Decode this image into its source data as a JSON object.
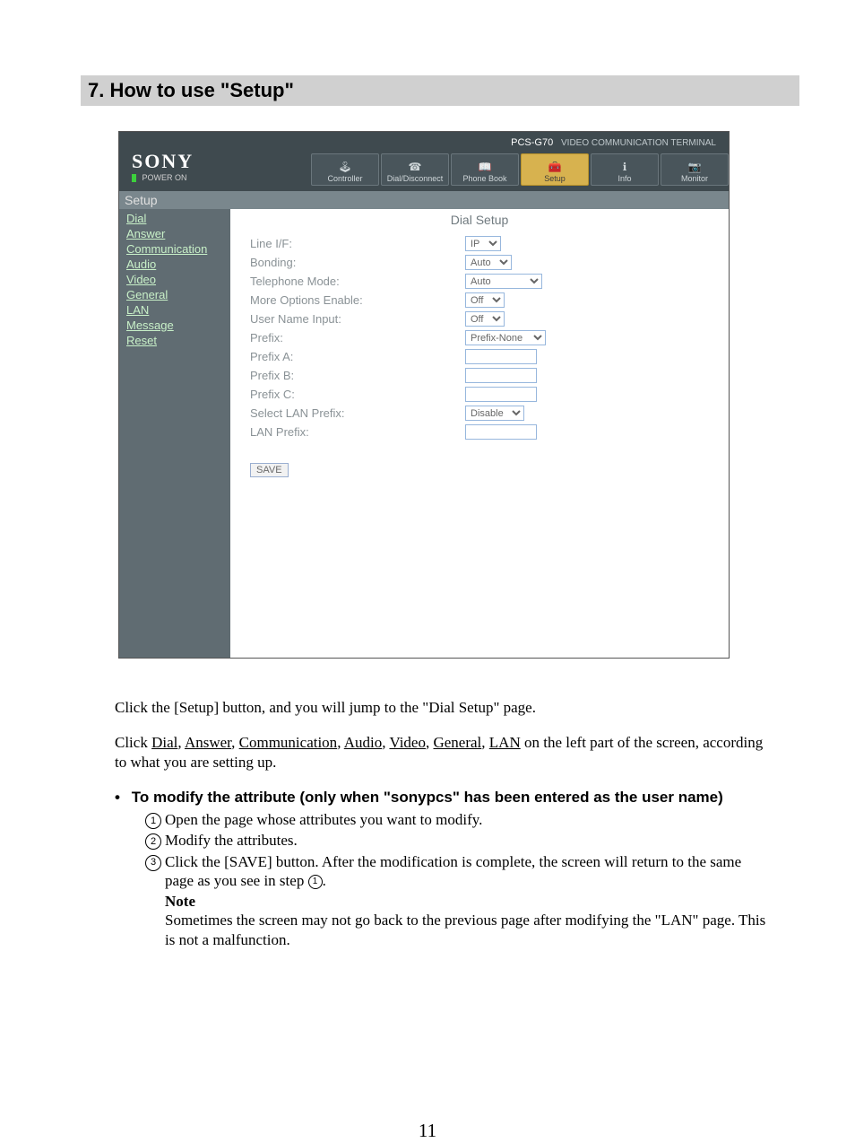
{
  "section": {
    "number": "7.",
    "title": "How to use \"Setup\""
  },
  "app": {
    "brand": "SONY",
    "power": "POWER ON",
    "model": "PCS-G70",
    "model_sub": "VIDEO COMMUNICATION TERMINAL",
    "tabs": {
      "controller": "Controller",
      "dial": "Dial/Disconnect",
      "phonebook": "Phone Book",
      "setup": "Setup",
      "info": "Info",
      "monitor": "Monitor"
    },
    "setup_label": "Setup",
    "sidebar": {
      "dial": "Dial",
      "answer": "Answer",
      "communication": "Communication",
      "audio": "Audio",
      "video": "Video",
      "general": "General",
      "lan": "LAN",
      "message": "Message",
      "reset": "Reset"
    },
    "content_title": "Dial Setup",
    "form": {
      "line_if": {
        "label": "Line I/F:",
        "value": "IP"
      },
      "bonding": {
        "label": "Bonding:",
        "value": "Auto"
      },
      "tel_mode": {
        "label": "Telephone Mode:",
        "value": "Auto"
      },
      "more_opts": {
        "label": "More Options Enable:",
        "value": "Off"
      },
      "user_name": {
        "label": "User Name Input:",
        "value": "Off"
      },
      "prefix": {
        "label": "Prefix:",
        "value": "Prefix-None"
      },
      "prefix_a": {
        "label": "Prefix A:",
        "value": ""
      },
      "prefix_b": {
        "label": "Prefix B:",
        "value": ""
      },
      "prefix_c": {
        "label": "Prefix C:",
        "value": ""
      },
      "sel_lan_prefix": {
        "label": "Select LAN Prefix:",
        "value": "Disable"
      },
      "lan_prefix": {
        "label": "LAN Prefix:",
        "value": ""
      }
    },
    "save": "SAVE"
  },
  "instr": {
    "p1a": "Click the [Setup] button, and you will jump to the \"Dial Setup\" page.",
    "p2_pre": "Click ",
    "links": {
      "dial": "Dial",
      "answer": "Answer",
      "communication": "Communication",
      "audio": "Audio",
      "video": "Video",
      "general": "General",
      "lan": "LAN"
    },
    "p2_post": " on the left part of the screen, according to what you are setting up.",
    "bullet": "To modify the attribute (only when \"sonypcs\" has been entered as the user name)",
    "s1": "Open the page whose attributes you want to modify.",
    "s2": "Modify the attributes.",
    "s3a": "Click the [SAVE] button. After the modification is complete, the screen will return to the same page as you see in step ",
    "s3b": ".",
    "note_label": "Note",
    "note": "Sometimes the screen may not go back to the previous page after modifying the \"LAN\" page. This is not a malfunction."
  },
  "pagenum": "11"
}
